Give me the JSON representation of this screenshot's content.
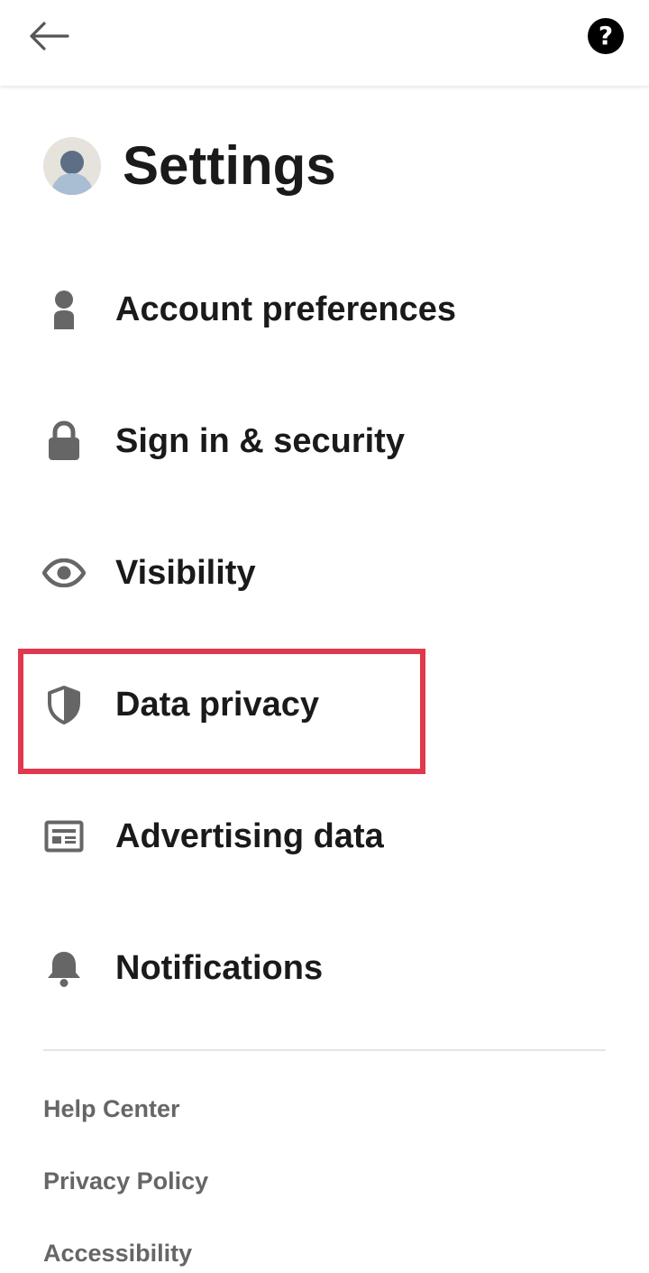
{
  "header": {
    "back_icon": "arrow-left-icon",
    "help_icon": "question-circle-icon",
    "help_glyph": "?"
  },
  "page": {
    "title": "Settings",
    "avatar_icon": "user-avatar-icon"
  },
  "settings": [
    {
      "label": "Account preferences",
      "icon": "person-icon"
    },
    {
      "label": "Sign in & security",
      "icon": "lock-icon"
    },
    {
      "label": "Visibility",
      "icon": "eye-icon"
    },
    {
      "label": "Data privacy",
      "icon": "shield-icon",
      "highlighted": true
    },
    {
      "label": "Advertising data",
      "icon": "newspaper-icon"
    },
    {
      "label": "Notifications",
      "icon": "bell-icon"
    }
  ],
  "footer": {
    "links": [
      "Help Center",
      "Privacy Policy",
      "Accessibility"
    ]
  },
  "colors": {
    "highlight": "#e0384d",
    "icon": "#666666",
    "text": "#1a1a1a",
    "footer_text": "#666666"
  }
}
